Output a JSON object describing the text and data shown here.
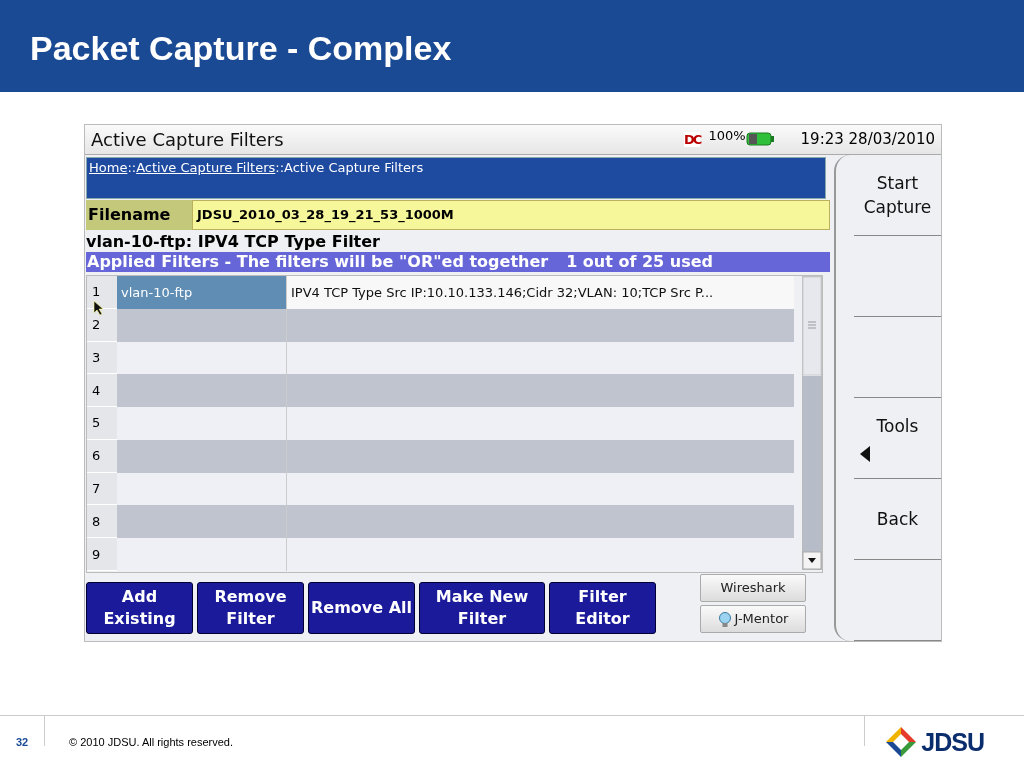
{
  "slide": {
    "title": "Packet Capture - Complex",
    "page_number": "32",
    "copyright": "© 2010 JDSU. All rights reserved.",
    "logo_text": "JDSU"
  },
  "device": {
    "window_title": "Active Capture Filters",
    "status": {
      "mode_badge": "DC",
      "battery_text": "100%",
      "clock": "19:23 28/03/2010"
    },
    "breadcrumb": {
      "separator": "::",
      "items": [
        {
          "label": "Home",
          "link": true
        },
        {
          "label": "Active Capture Filters",
          "link": true
        },
        {
          "label": "Active Capture Filters",
          "link": false
        }
      ]
    },
    "filename": {
      "label": "Filename",
      "value": "JDSU_2010_03_28_19_21_53_1000M"
    },
    "filter_title": "vlan-10-ftp: IPV4 TCP Type Filter",
    "applied_bar": {
      "text": "Applied Filters - The filters will be \"OR\"ed together",
      "count": "1 out of 25 used"
    },
    "rows": [
      {
        "number": "1",
        "name": "vlan-10-ftp",
        "description": "IPV4 TCP Type Src IP:10.10.133.146;Cidr 32;VLAN: 10;TCP Src P...",
        "selected": true
      },
      {
        "number": "2",
        "selected": false
      },
      {
        "number": "3",
        "selected": false
      },
      {
        "number": "4",
        "selected": false
      },
      {
        "number": "5",
        "selected": false
      },
      {
        "number": "6",
        "selected": false
      },
      {
        "number": "7",
        "selected": false
      },
      {
        "number": "8",
        "selected": false
      },
      {
        "number": "9",
        "selected": false
      }
    ],
    "buttons": [
      "Add Existing",
      "Remove Filter",
      "Remove All",
      "Make New Filter",
      "Filter Editor"
    ],
    "small_buttons": [
      {
        "label": "Wireshark",
        "kind": "plain"
      },
      {
        "label": "J-Mentor",
        "kind": "help"
      }
    ],
    "softkeys": [
      {
        "kind": "label",
        "label": "Start Capture"
      },
      {
        "kind": "blank"
      },
      {
        "kind": "blank"
      },
      {
        "kind": "submenu",
        "label": "Tools"
      },
      {
        "kind": "label",
        "label": "Back"
      },
      {
        "kind": "blank"
      }
    ]
  }
}
